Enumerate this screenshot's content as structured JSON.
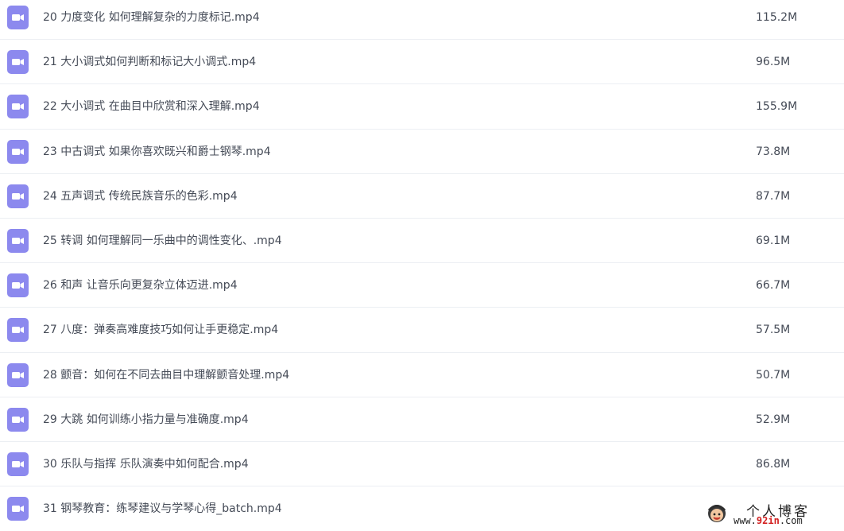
{
  "files": [
    {
      "name": "20 力度变化 如何理解复杂的力度标记.mp4",
      "size": "115.2M",
      "icon": "video-file-icon"
    },
    {
      "name": "21 大小调式如何判断和标记大小调式.mp4",
      "size": "96.5M",
      "icon": "video-file-icon"
    },
    {
      "name": "22 大小调式 在曲目中欣赏和深入理解.mp4",
      "size": "155.9M",
      "icon": "video-file-icon"
    },
    {
      "name": "23 中古调式 如果你喜欢既兴和爵士钢琴.mp4",
      "size": "73.8M",
      "icon": "video-file-icon"
    },
    {
      "name": "24 五声调式 传统民族音乐的色彩.mp4",
      "size": "87.7M",
      "icon": "video-file-icon"
    },
    {
      "name": "25 转调 如何理解同一乐曲中的调性变化、.mp4",
      "size": "69.1M",
      "icon": "video-file-icon"
    },
    {
      "name": "26 和声 让音乐向更复杂立体迈进.mp4",
      "size": "66.7M",
      "icon": "video-file-icon"
    },
    {
      "name": "27 八度：弹奏高难度技巧如何让手更稳定.mp4",
      "size": "57.5M",
      "icon": "video-file-icon"
    },
    {
      "name": "28 颤音：如何在不同去曲目中理解颤音处理.mp4",
      "size": "50.7M",
      "icon": "video-file-icon"
    },
    {
      "name": "29 大跳 如何训练小指力量与准确度.mp4",
      "size": "52.9M",
      "icon": "video-file-icon"
    },
    {
      "name": "30 乐队与指挥 乐队演奏中如何配合.mp4",
      "size": "86.8M",
      "icon": "video-file-icon"
    },
    {
      "name": "31 钢琴教育：练琴建议与学琴心得_batch.mp4",
      "size": "",
      "icon": "video-file-icon"
    }
  ],
  "watermark": {
    "title": "个人博客",
    "url_prefix": "www.",
    "url_accent": "92in",
    "url_suffix": ".com"
  },
  "colors": {
    "icon_bg": "#8c89ee",
    "text": "#454b57",
    "row_divider": "#eceff3",
    "watermark_accent": "#d21f1f"
  }
}
